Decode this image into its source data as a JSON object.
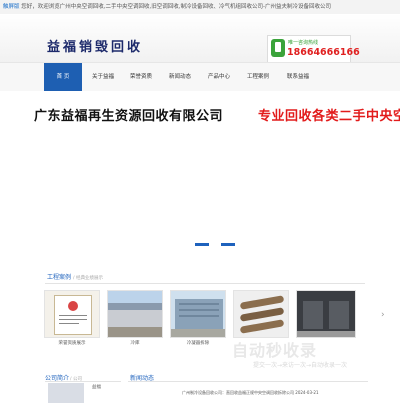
{
  "topbar": {
    "link": "触屏版",
    "message": "您好，欢迎浏览广州中央空调回收,二手中央空调回收,旧空调回收,制冷设备回收、冷气机组回收公司-广州益夫制冷设备回收公司"
  },
  "header": {
    "logo": "益福销毁回收",
    "hotline_label": "唯一咨询热线",
    "hotline_number": "18664666166"
  },
  "nav": {
    "items": [
      "首 页",
      "关于益福",
      "荣誉资质",
      "新闻动态",
      "产品中心",
      "工程案例",
      "联系益福"
    ],
    "active_index": 0
  },
  "banner": {
    "line1": "广东益福再生资源回收有限公司",
    "line2": "专业回收各类二手中央空调"
  },
  "cases": {
    "title": "工程案例",
    "subtitle": "/ 经典业绩展示",
    "items": [
      {
        "caption": "荣誉资质展示"
      },
      {
        "caption": "冷库"
      },
      {
        "caption": "冷凝器拆除"
      },
      {
        "caption": ""
      },
      {
        "caption": ""
      }
    ]
  },
  "watermark": {
    "brand": "自动秒收录",
    "slogan": "提交一次→来访一次→自动收录一次"
  },
  "about": {
    "title": "公司简介",
    "subtitle": "/ 公司",
    "text": "益福"
  },
  "news": {
    "title": "新闻动态",
    "text": "广州制冷设备回收公司：直回收益福正规中央空调回收拆除公司  2024-03-21"
  },
  "colors": {
    "accent_blue": "#1e62bd",
    "logo_navy": "#1d2a6b",
    "hotline_red": "#e02020",
    "hotline_green": "#3aa33a",
    "banner_red": "#e21b1b"
  },
  "icons": [
    "phone-icon",
    "next-arrow-icon"
  ]
}
